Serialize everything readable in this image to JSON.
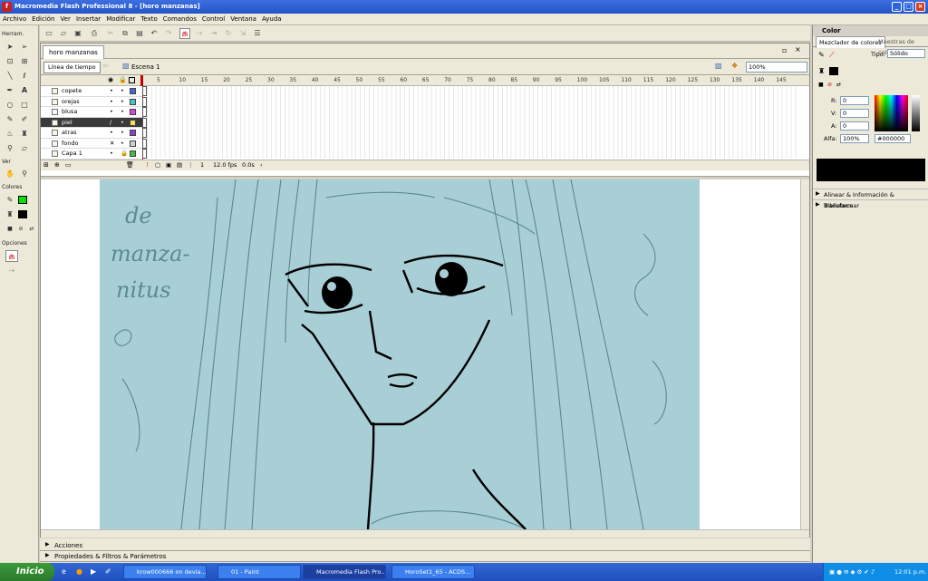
{
  "window": {
    "title": "Macromedia Flash Professional 8 - [horo manzanas]",
    "app_icon": "flash-icon"
  },
  "menu": [
    "Archivo",
    "Edición",
    "Ver",
    "Insertar",
    "Modificar",
    "Texto",
    "Comandos",
    "Control",
    "Ventana",
    "Ayuda"
  ],
  "tools": {
    "header": "Herram.",
    "view": "Ver",
    "colors": "Colores",
    "options": "Opciones"
  },
  "document": {
    "tab": "horo manzanas",
    "timeline_button": "Línea de tiempo",
    "scene": "Escena 1",
    "zoom": "100%"
  },
  "timeline": {
    "frame_numbers": [
      "5",
      "10",
      "15",
      "20",
      "25",
      "30",
      "35",
      "40",
      "45",
      "50",
      "55",
      "60",
      "65",
      "70",
      "75",
      "80",
      "85",
      "90",
      "95",
      "100",
      "105",
      "110",
      "115",
      "120",
      "125",
      "130",
      "135",
      "140",
      "145"
    ],
    "layers": [
      {
        "name": "copete",
        "dot1": "•",
        "dot2": "•",
        "color": "#3f6ad8"
      },
      {
        "name": "orejas",
        "dot1": "•",
        "dot2": "•",
        "color": "#40c8c8"
      },
      {
        "name": "blusa",
        "dot1": "•",
        "dot2": "•",
        "color": "#e040e0"
      },
      {
        "name": "piel",
        "dot1": "/",
        "dot2": "•",
        "color": "#f0e060",
        "selected": true
      },
      {
        "name": "atras",
        "dot1": "•",
        "dot2": "•",
        "color": "#8a40c8"
      },
      {
        "name": "fondo",
        "dot1": "✕",
        "dot2": "•",
        "color": "#d0d0d0"
      },
      {
        "name": "Capa 1",
        "dot1": "•",
        "dot2": "🔒",
        "color": "#40c040"
      }
    ],
    "current_frame": "1",
    "fps": "12.0 fps",
    "time": "0.0s"
  },
  "sketch_text": [
    "de",
    "manza-",
    "nitus"
  ],
  "panels": {
    "actions": "Acciones",
    "properties": "Propiedades & Filtros & Parámetros"
  },
  "color_panel": {
    "title": "Color",
    "tab_mixer": "Mezclador de colores",
    "tab_swatches": "Muestras de color",
    "type_label": "Tipo:",
    "type_value": "Sólido",
    "r_label": "R:",
    "r": "0",
    "g_label": "V:",
    "g": "0",
    "b_label": "A:",
    "b": "0",
    "alpha_label": "Alfa:",
    "alpha": "100%",
    "hex": "#000000"
  },
  "right_panels": {
    "align": "Alinear & Información & Transformar",
    "library": "Biblioteca"
  },
  "taskbar": {
    "start": "Inicio",
    "tasks": [
      "krow000666 on devia...",
      "01 - Paint",
      "Macromedia Flash Pro...",
      "HoroSet1_65 - ACDS..."
    ],
    "clock": "12:01 p.m."
  }
}
